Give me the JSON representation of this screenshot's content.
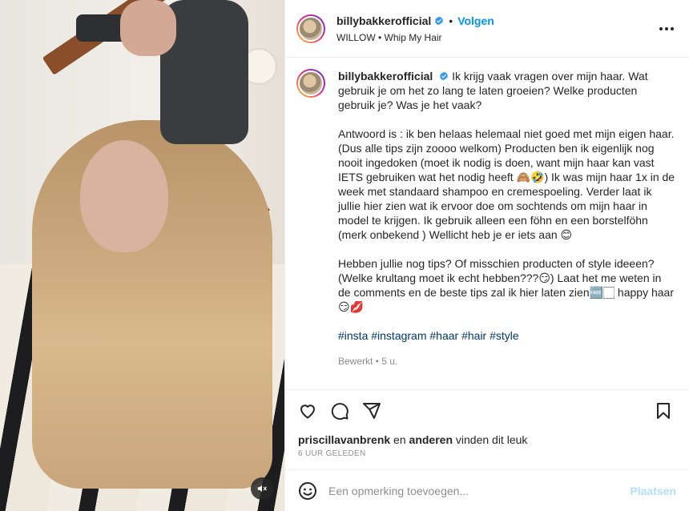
{
  "post": {
    "username": "billybakkerofficial",
    "follow_label": "Volgen",
    "dot": "•",
    "audio": "WILLOW • Whip My Hair"
  },
  "caption": {
    "username": "billybakkerofficial",
    "paragraph1": "Ik krijg vaak vragen over mijn haar. Wat gebruik je om het zo lang te laten groeien? Welke producten gebruik je? Was je het vaak?",
    "paragraph2": "Antwoord is : ik ben helaas helemaal niet goed met mijn eigen haar. (Dus alle tips zijn zoooo welkom) Producten ben ik eigenlijk nog nooit ingedoken (moet ik nodig is doen, want mijn haar kan vast IETS gebruiken wat het nodig heeft 🙈🤣) Ik was mijn haar 1x in de week met standaard shampoo en cremespoeling. Verder laat ik jullie hier zien wat ik ervoor doe om sochtends om mijn haar in model te krijgen. Ik gebruik alleen een föhn en een borstelföhn (merk onbekend ) Wellicht heb je er iets aan 😊",
    "paragraph3": "Hebben jullie nog tips? Of misschien producten of style ideeen? (Welke krultang moet ik echt hebben???😏) Laat het me weten in de comments en de beste tips zal ik hier laten zien🆓🏻 happy haar😏💋",
    "hashtags": "#insta #instagram #haar #hair #style",
    "edited": "Bewerkt • 5 u."
  },
  "likes": {
    "user": "priscillavanbrenk",
    "mid": " en ",
    "others": "anderen",
    "suffix": " vinden dit leuk"
  },
  "timestamp": "6 UUR GELEDEN",
  "comment": {
    "placeholder": "Een opmerking toevoegen...",
    "post_label": "Plaatsen"
  },
  "colors": {
    "accent": "#0095f6",
    "post_disabled": "#b2dffc",
    "secondary_text": "#8e8e8e",
    "hashtag": "#00376b"
  },
  "icons": [
    "more-options-icon",
    "verified-badge-icon",
    "heart-icon",
    "comment-icon",
    "share-icon",
    "bookmark-icon",
    "emoji-icon",
    "muted-audio-icon"
  ]
}
